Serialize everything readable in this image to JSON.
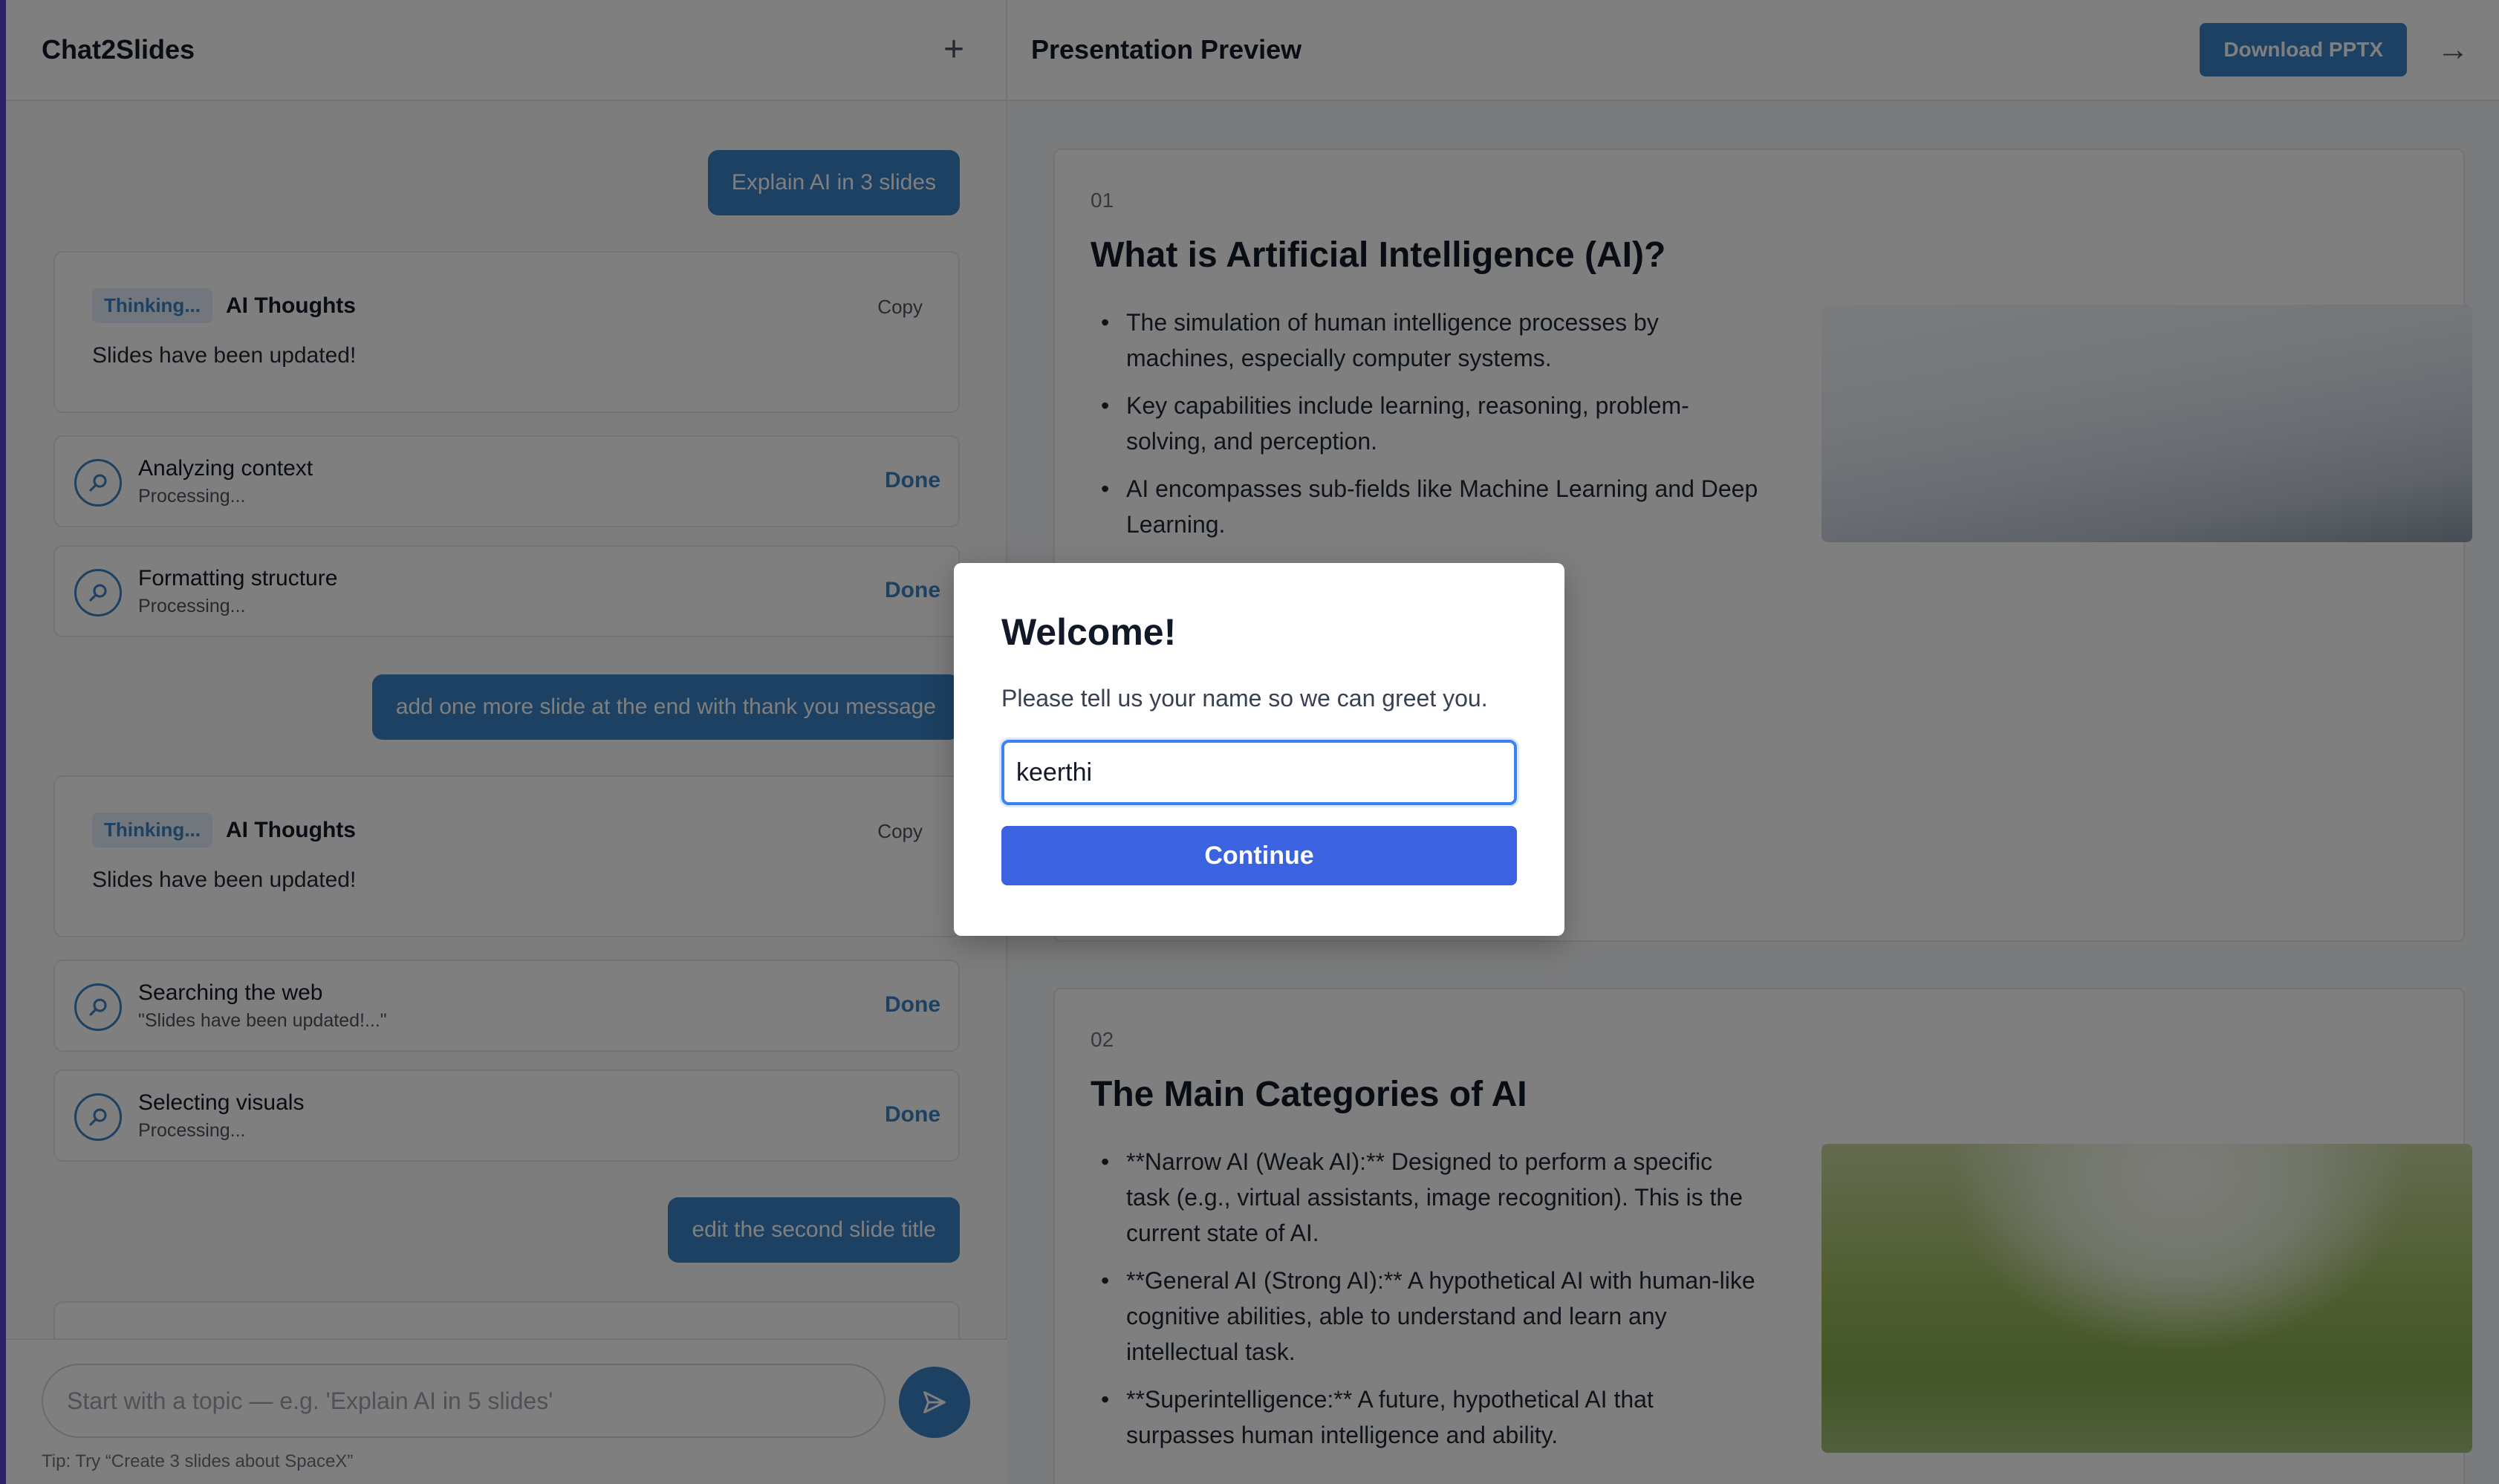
{
  "app": {
    "title": "Chat2Slides",
    "new_chat_icon": "plus-icon"
  },
  "chat": {
    "messages": [
      {
        "type": "user",
        "text": "Explain AI in 3 slides"
      },
      {
        "type": "thoughts",
        "badge": "Thinking...",
        "title": "AI Thoughts",
        "copy_label": "Copy",
        "body": "Slides have been updated!"
      },
      {
        "type": "step",
        "icon": "search-icon",
        "title": "Analyzing context",
        "subtitle": "Processing...",
        "status": "Done"
      },
      {
        "type": "step",
        "icon": "search-icon",
        "title": "Formatting structure",
        "subtitle": "Processing...",
        "status": "Done"
      },
      {
        "type": "user",
        "text": "add one more slide at the end with thank you message"
      },
      {
        "type": "thoughts",
        "badge": "Thinking...",
        "title": "AI Thoughts",
        "copy_label": "Copy",
        "body": "Slides have been updated!"
      },
      {
        "type": "step",
        "icon": "search-icon",
        "title": "Searching the web",
        "subtitle": "\"Slides have been updated!...\"",
        "status": "Done"
      },
      {
        "type": "step",
        "icon": "search-icon",
        "title": "Selecting visuals",
        "subtitle": "Processing...",
        "status": "Done"
      },
      {
        "type": "user",
        "text": "edit the second slide title"
      }
    ],
    "composer": {
      "placeholder": "Start with a topic — e.g. 'Explain AI in 5 slides'",
      "send_icon": "send-icon",
      "tip": "Tip: Try “Create 3 slides about SpaceX”"
    }
  },
  "preview": {
    "title": "Presentation Preview",
    "download_label": "Download PPTX",
    "collapse_icon": "arrow-right-icon",
    "slides": [
      {
        "number": "01",
        "title": "What is Artificial Intelligence (AI)?",
        "bullets": [
          "The simulation of human intelligence processes by machines, especially computer systems.",
          "Key capabilities include learning, reasoning, problem-solving, and perception.",
          "AI encompasses sub-fields like Machine Learning and Deep Learning."
        ],
        "image": "snow-landscape-image"
      },
      {
        "number": "02",
        "title": "The Main Categories of AI",
        "bullets": [
          "**Narrow AI (Weak AI):** Designed to perform a specific task (e.g., virtual assistants, image recognition). This is the current state of AI.",
          "**General AI (Strong AI):** A hypothetical AI with human-like cognitive abilities, able to understand and learn any intellectual task.",
          "**Superintelligence:** A future, hypothetical AI that surpasses human intelligence and ability."
        ],
        "image": "green-blur-image"
      }
    ]
  },
  "modal": {
    "title": "Welcome!",
    "description": "Please tell us your name so we can greet you.",
    "input_value": "keerthi",
    "continue_label": "Continue"
  },
  "colors": {
    "accent": "#3b82c4",
    "modal_button": "#3b63e0",
    "left_accent": "#5b3fd0"
  }
}
